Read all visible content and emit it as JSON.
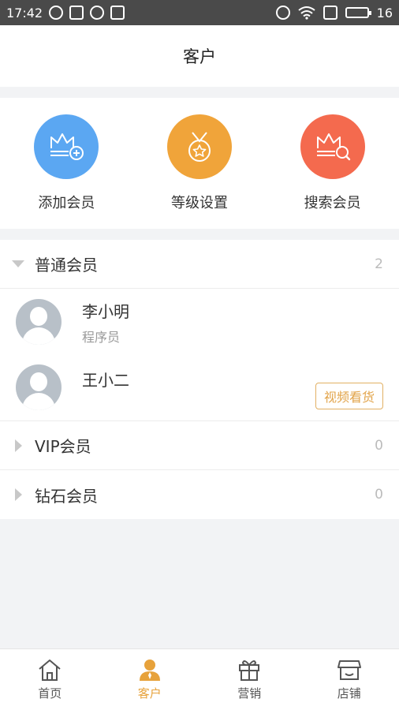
{
  "status_bar": {
    "time": "17:42",
    "battery": "16"
  },
  "header": {
    "title": "客户"
  },
  "quick_actions": [
    {
      "label": "添加会员",
      "icon": "crown-add-icon",
      "color": "#5ba7f2"
    },
    {
      "label": "等级设置",
      "icon": "medal-icon",
      "color": "#f0a43a"
    },
    {
      "label": "搜索会员",
      "icon": "crown-search-icon",
      "color": "#f46a4e"
    }
  ],
  "groups": [
    {
      "name": "普通会员",
      "count": "2",
      "expanded": true,
      "members": [
        {
          "name": "李小明",
          "role": "程序员"
        },
        {
          "name": "王小二",
          "role": "",
          "action": "视频看货"
        }
      ]
    },
    {
      "name": "VIP会员",
      "count": "0",
      "expanded": false
    },
    {
      "name": "钻石会员",
      "count": "0",
      "expanded": false
    }
  ],
  "tabbar": {
    "items": [
      {
        "label": "首页",
        "icon": "home-icon"
      },
      {
        "label": "客户",
        "icon": "person-icon",
        "active": true
      },
      {
        "label": "营销",
        "icon": "gift-icon"
      },
      {
        "label": "店铺",
        "icon": "shop-icon"
      }
    ],
    "active_color": "#e7a23b"
  }
}
